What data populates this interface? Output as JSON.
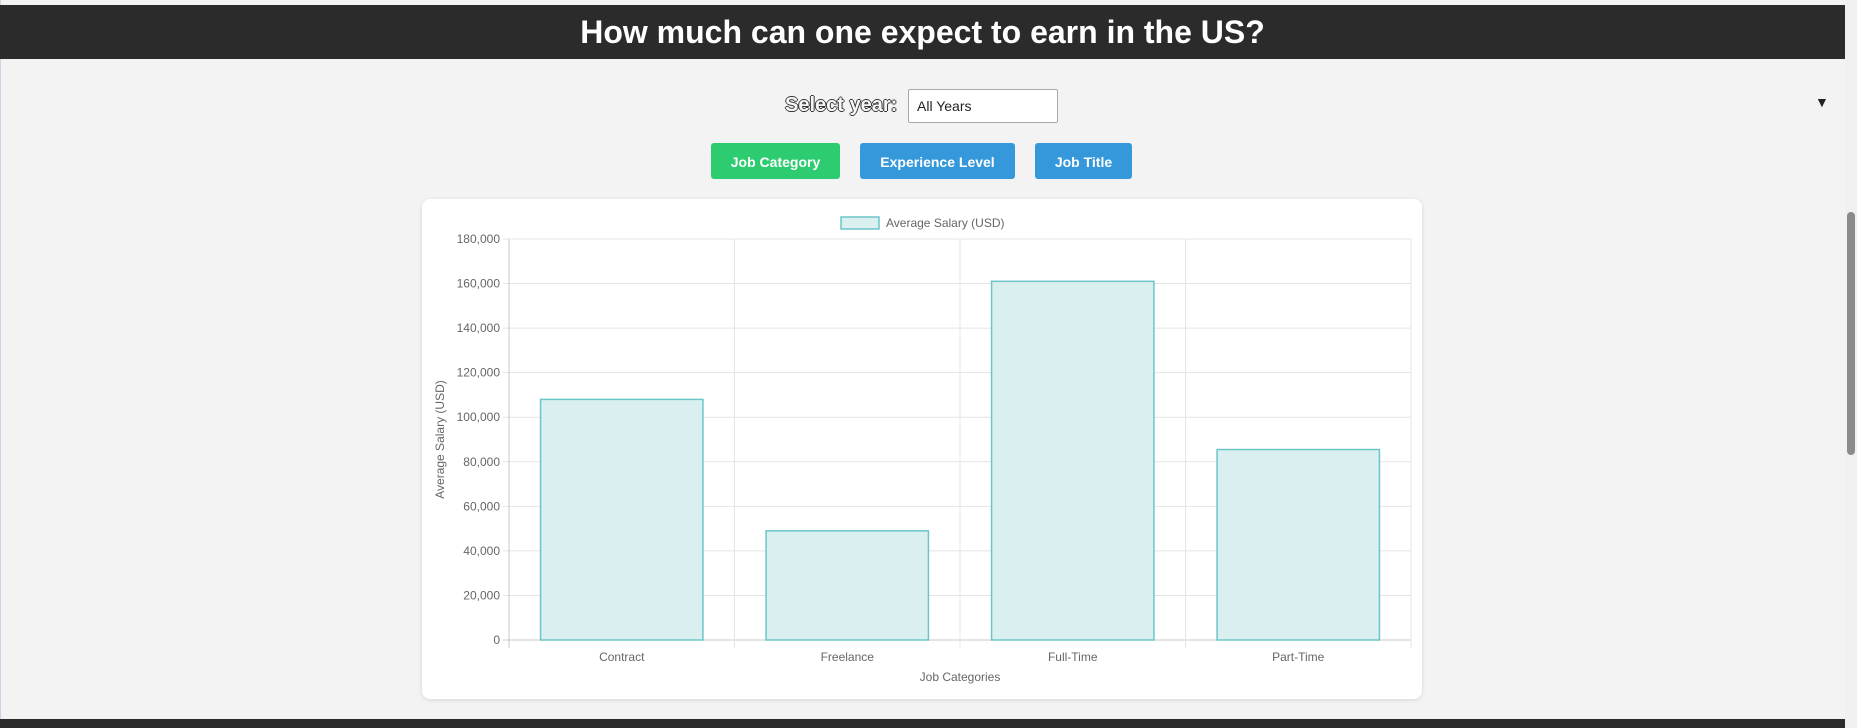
{
  "header": {
    "title": "How much can one expect to earn in the US?"
  },
  "controls": {
    "year_label": "Select year:",
    "year_selected": "All Years",
    "dropdown_icon": "triangle-down-icon"
  },
  "buttons": {
    "job_category": "Job Category",
    "experience_level": "Experience Level",
    "job_title": "Job Title",
    "active_color": "#2ecc71",
    "inactive_color": "#3498db"
  },
  "chart_data": {
    "type": "bar",
    "categories": [
      "Contract",
      "Freelance",
      "Full-Time",
      "Part-Time"
    ],
    "series": [
      {
        "name": "Average Salary (USD)",
        "values": [
          108000,
          49000,
          161000,
          85500
        ],
        "fill_color": "#daf0f0",
        "border_color": "#6cc5c7"
      }
    ],
    "xlabel": "Job Categories",
    "ylabel": "Average Salary (USD)",
    "ylim": [
      0,
      180000
    ],
    "yticks": [
      0,
      20000,
      40000,
      60000,
      80000,
      100000,
      120000,
      140000,
      160000,
      180000
    ],
    "ytick_labels": [
      "0",
      "20,000",
      "40,000",
      "60,000",
      "80,000",
      "100,000",
      "120,000",
      "140,000",
      "160,000",
      "180,000"
    ],
    "legend_position": "top-center",
    "grid": true
  }
}
